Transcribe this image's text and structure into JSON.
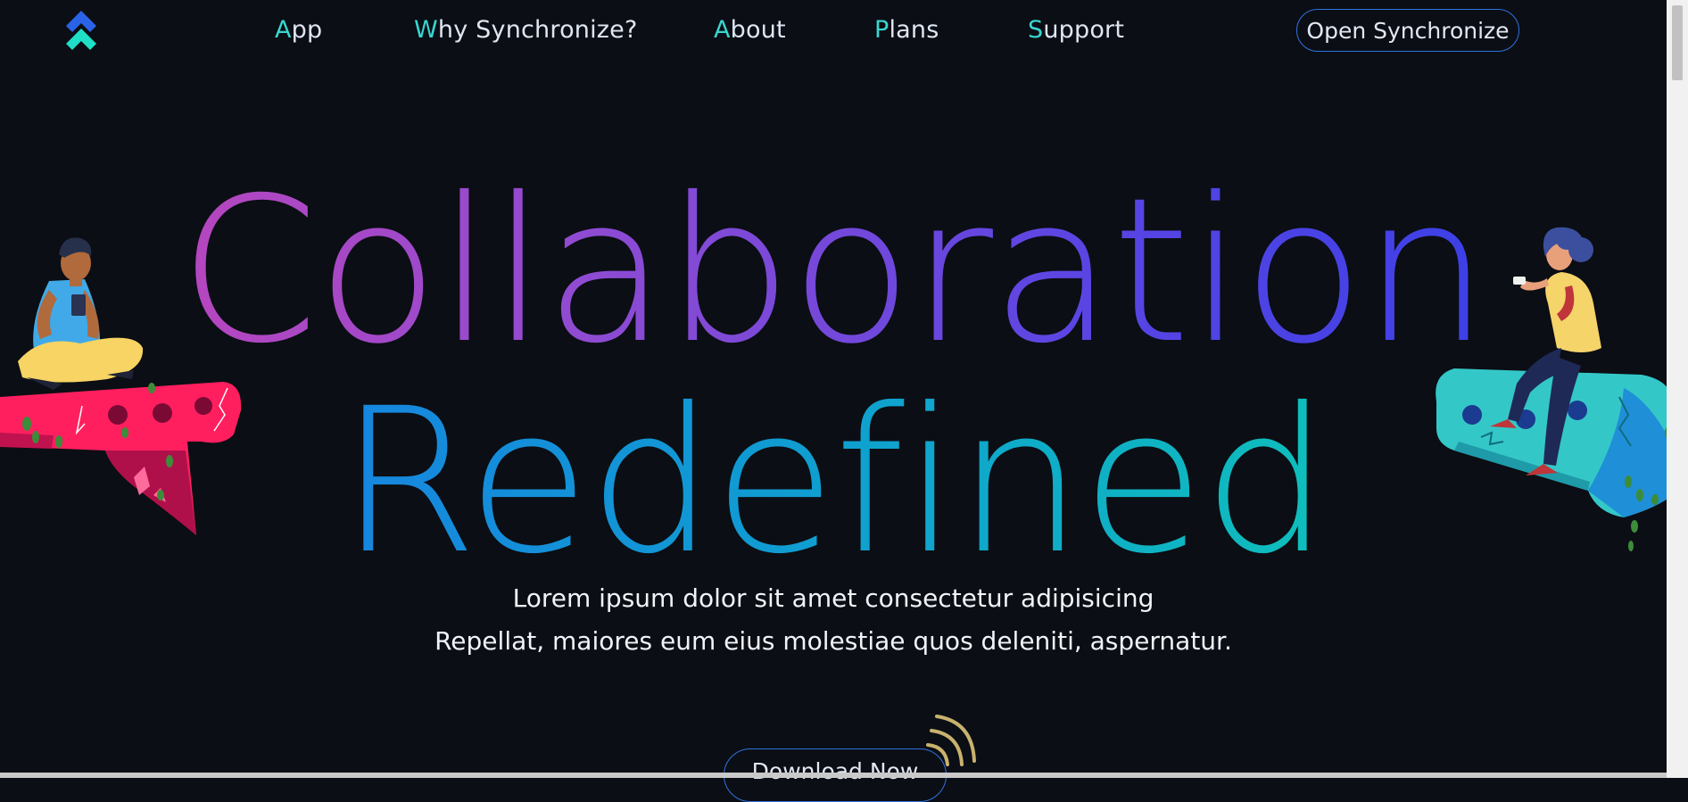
{
  "nav": {
    "logo_icon": "double-chevron-up-icon",
    "items": [
      {
        "first": "A",
        "rest": "pp"
      },
      {
        "first": "W",
        "rest": "hy Synchronize?"
      },
      {
        "first": "A",
        "rest": "bout"
      },
      {
        "first": "P",
        "rest": "lans"
      },
      {
        "first": "S",
        "rest": "upport"
      }
    ],
    "open_button": "Open Synchronize"
  },
  "hero": {
    "title_line1": "Collaboration",
    "title_line2": "Redefined",
    "subtitle_line1": "Lorem ipsum dolor sit amet consectetur adipisicing",
    "subtitle_line2": "Repellat, maiores eum eius molestiae quos deleniti, aspernatur.",
    "download_button": "Download Now",
    "signal_icon": "signal-waves-icon"
  },
  "colors": {
    "background": "#0b0e14",
    "accent_blue": "#2f73e0",
    "accent_teal": "#38d6d1",
    "title_gradient_1": [
      "#c844b6",
      "#2f3ee8"
    ],
    "title_gradient_2": [
      "#1c74e8",
      "#0fd4ad"
    ],
    "left_rock": "#ff1f5f",
    "right_rock": "#34c7c8"
  }
}
